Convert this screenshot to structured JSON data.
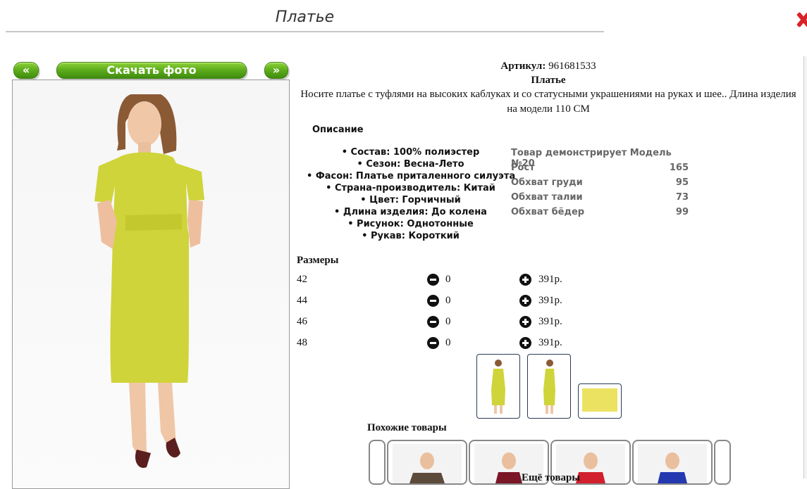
{
  "page": {
    "title": "Платье"
  },
  "gallery": {
    "prev_label": "«",
    "download_label": "Скачать фото",
    "next_label": "»"
  },
  "product": {
    "sku_label": "Артикул:",
    "sku": "961681533",
    "name": "Платье",
    "description": "Носите платье с туфлями на высоких каблуках и со статусными украшениями на руках и шее.. Длина изделия на модели 110 СМ",
    "color_hex": "#cfd43a"
  },
  "description_section": {
    "heading": "Описание",
    "properties": [
      "Состав: 100% полиэстер",
      "Сезон: Весна-Лето",
      "Фасон: Платье приталенного силуэта",
      "Страна-производитель: Китай",
      "Цвет: Горчичный",
      "Длина изделия: До колена",
      "Рисунок: Однотонные",
      "Рукав: Короткий"
    ]
  },
  "model_info": {
    "heading": "Товар демонстрирует Модель №20",
    "rows": [
      {
        "label": "Рост",
        "value": "165"
      },
      {
        "label": "Обхват груди",
        "value": "95"
      },
      {
        "label": "Обхват талии",
        "value": "73"
      },
      {
        "label": "Обхват бёдер",
        "value": "99"
      }
    ]
  },
  "sizes": {
    "heading": "Размеры",
    "rows": [
      {
        "size": "42",
        "qty": "0",
        "price": "391р."
      },
      {
        "size": "44",
        "qty": "0",
        "price": "391р."
      },
      {
        "size": "46",
        "qty": "0",
        "price": "391р."
      },
      {
        "size": "48",
        "qty": "0",
        "price": "391р."
      }
    ]
  },
  "similar": {
    "heading": "Похожие товары"
  },
  "more": {
    "heading": "Ещё товары"
  }
}
